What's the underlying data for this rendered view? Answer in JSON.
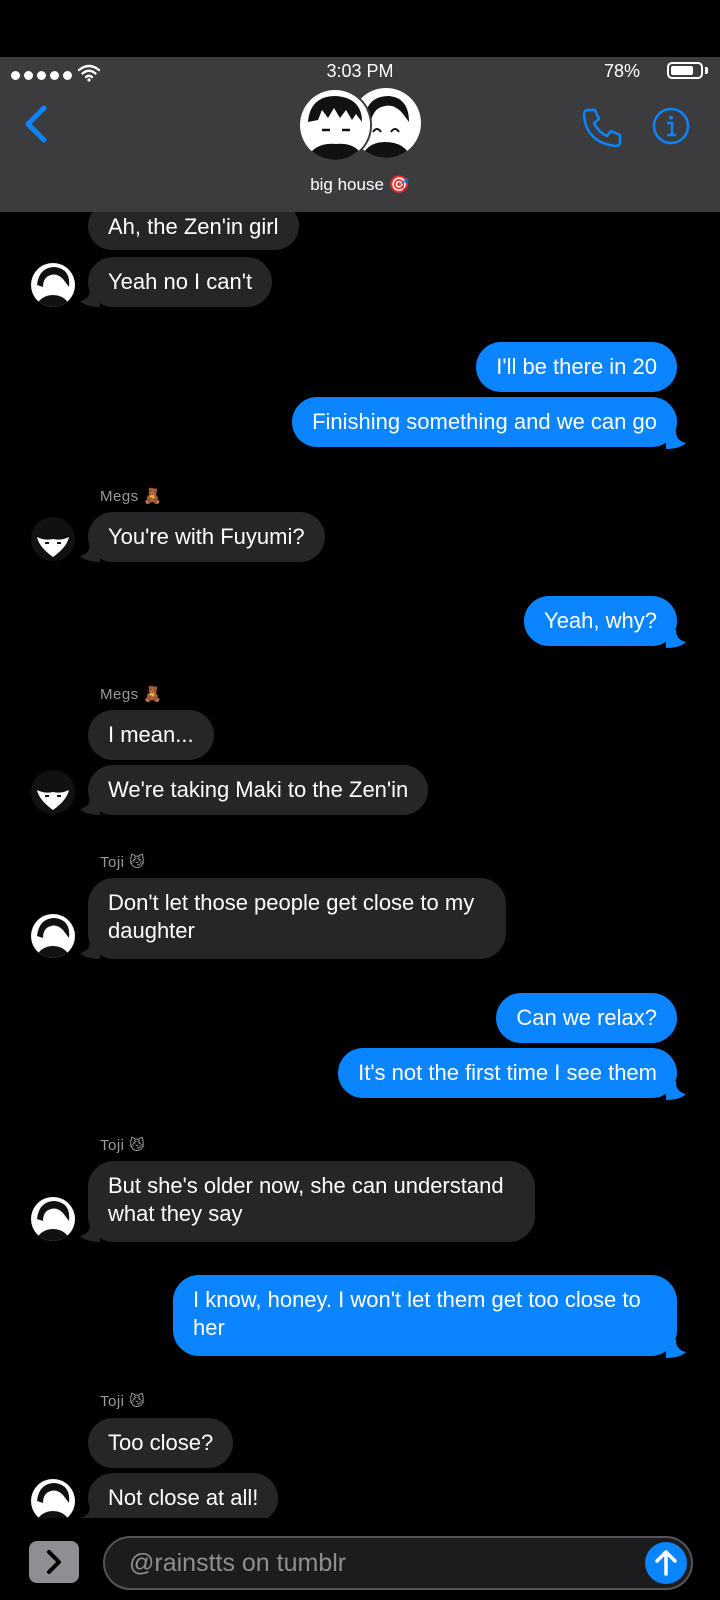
{
  "status_bar": {
    "time": "3:03 PM",
    "battery": "78%",
    "battery_level": 0.78
  },
  "header": {
    "group_name": "big house 🎯"
  },
  "messages": [
    {
      "text": "Ah, the Zen'in girl"
    },
    {
      "text": "Yeah no I can't"
    },
    {
      "text": "I'll be there in 20"
    },
    {
      "text": "Finishing something and we can go"
    },
    {
      "sender": "Megs 🧸",
      "text": "You're with Fuyumi?"
    },
    {
      "text": "Yeah, why?"
    },
    {
      "sender": "Megs 🧸",
      "text": "I mean..."
    },
    {
      "text": "We're taking Maki to the Zen'in"
    },
    {
      "sender": "Toji 😼",
      "text": "Don't let those people get close to my daughter"
    },
    {
      "text": "Can we relax?"
    },
    {
      "text": "It's not the first time I see them"
    },
    {
      "sender": "Toji 😼",
      "text": "But she's older now, she can understand what they say"
    },
    {
      "text": "I know, honey. I won't let them get too close to her"
    },
    {
      "sender": "Toji 😼",
      "text": "Too close?"
    },
    {
      "text": "Not close at all!"
    }
  ],
  "input": {
    "placeholder": "@rainstts on tumblr"
  },
  "colors": {
    "accent": "#0a84ff",
    "incoming": "#262628",
    "header": "#3c3c3e"
  },
  "icons": [
    "back-chevron-icon",
    "phone-icon",
    "info-icon",
    "wifi-icon",
    "expand-icon",
    "send-arrow-icon"
  ]
}
